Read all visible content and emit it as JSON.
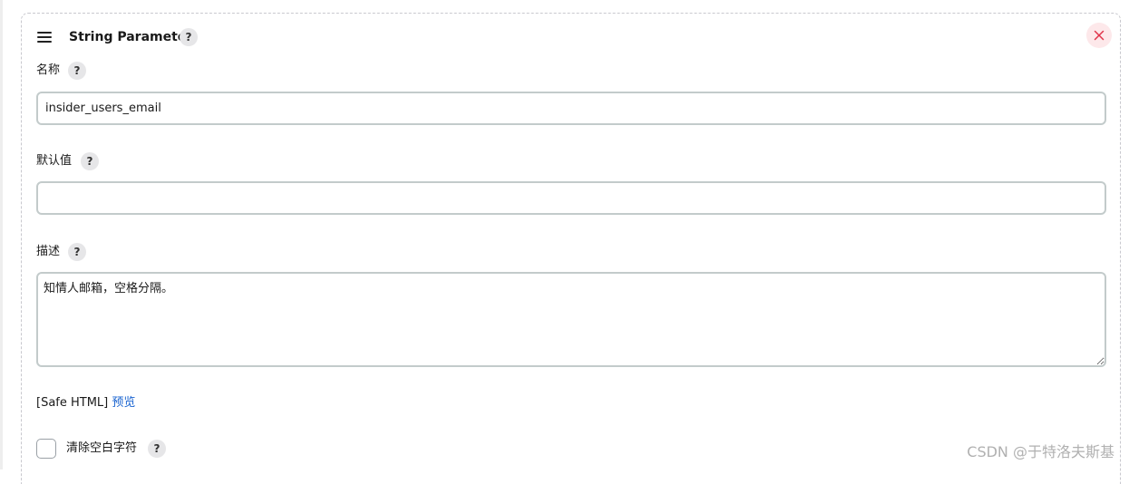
{
  "header": {
    "title": "String Parameter",
    "help": "?",
    "close_icon": "close-icon",
    "drag_icon": "drag-handle-icon"
  },
  "fields": {
    "name": {
      "label": "名称",
      "help": "?",
      "value": "insider_users_email"
    },
    "default_value": {
      "label": "默认值",
      "help": "?",
      "value": ""
    },
    "description": {
      "label": "描述",
      "help": "?",
      "value": "知情人邮箱，空格分隔。"
    }
  },
  "safe_html": {
    "text": "[Safe HTML]",
    "preview_link": "预览"
  },
  "trim": {
    "label": "清除空白字符",
    "help": "?",
    "checked": false
  },
  "watermark": "CSDN @于特洛夫斯基",
  "colors": {
    "link": "#1a64d0",
    "close_bg": "#fde8ea",
    "close_x": "#e0344a",
    "field_border": "#c3cbcb"
  }
}
